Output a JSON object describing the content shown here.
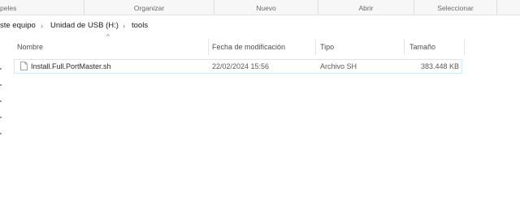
{
  "ribbon": {
    "groups": [
      "peles",
      "Organizar",
      "Nuevo",
      "Abrir",
      "Seleccionar"
    ]
  },
  "address": {
    "crumbs": [
      "ste equipo",
      "Unidad de USB (H:)",
      "tools"
    ]
  },
  "columns": {
    "name": "Nombre",
    "date": "Fecha de modificación",
    "type": "Tipo",
    "size": "Tamaño"
  },
  "files": [
    {
      "name": "Install.Full.PortMaster.sh",
      "date": "22/02/2024 15:56",
      "type": "Archivo SH",
      "size": "383.448 KB"
    }
  ],
  "icons": {
    "file": "document-icon",
    "sort": "sort-ascending-icon",
    "separator": "chevron-right-icon"
  },
  "colors": {
    "selection_border": "#cde8ff",
    "ribbon_bg": "#f7f7f7"
  }
}
